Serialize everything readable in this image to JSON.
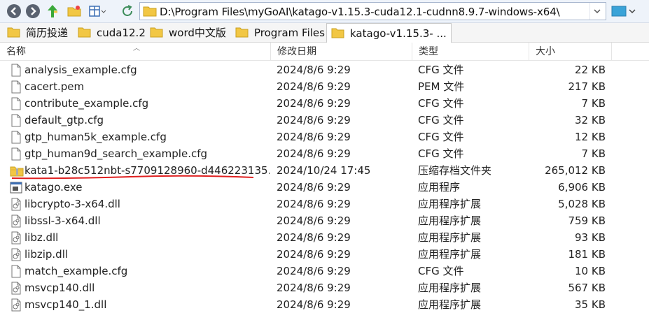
{
  "address": {
    "path": "D:\\Program Files\\myGoAI\\katago-v1.15.3-cuda12.1-cudnn8.9.7-windows-x64\\"
  },
  "favorites": [
    {
      "label": "简历投递"
    },
    {
      "label": "cuda12.2"
    },
    {
      "label": "word中文版"
    },
    {
      "label": "Program Files"
    },
    {
      "label": "katago-v1.15.3- ..."
    }
  ],
  "columns": {
    "name": "名称",
    "date": "修改日期",
    "type": "类型",
    "size": "大小"
  },
  "files": [
    {
      "name": "analysis_example.cfg",
      "date": "2024/8/6 9:29",
      "type": "CFG 文件",
      "size": "22 KB",
      "icon": "file-icon"
    },
    {
      "name": "cacert.pem",
      "date": "2024/8/6 9:29",
      "type": "PEM 文件",
      "size": "217 KB",
      "icon": "file-icon"
    },
    {
      "name": "contribute_example.cfg",
      "date": "2024/8/6 9:29",
      "type": "CFG 文件",
      "size": "7 KB",
      "icon": "file-icon"
    },
    {
      "name": "default_gtp.cfg",
      "date": "2024/8/6 9:29",
      "type": "CFG 文件",
      "size": "32 KB",
      "icon": "file-icon"
    },
    {
      "name": "gtp_human5k_example.cfg",
      "date": "2024/8/6 9:29",
      "type": "CFG 文件",
      "size": "12 KB",
      "icon": "file-icon"
    },
    {
      "name": "gtp_human9d_search_example.cfg",
      "date": "2024/8/6 9:29",
      "type": "CFG 文件",
      "size": "7 KB",
      "icon": "file-icon"
    },
    {
      "name": "kata1-b28c512nbt-s7709128960-d446223135...",
      "date": "2024/10/24 17:45",
      "type": "压缩存档文件夹",
      "size": "265,012 KB",
      "icon": "zip-folder-icon"
    },
    {
      "name": "katago.exe",
      "date": "2024/8/6 9:29",
      "type": "应用程序",
      "size": "6,906 KB",
      "icon": "exe-icon"
    },
    {
      "name": "libcrypto-3-x64.dll",
      "date": "2024/8/6 9:29",
      "type": "应用程序扩展",
      "size": "5,028 KB",
      "icon": "dll-icon"
    },
    {
      "name": "libssl-3-x64.dll",
      "date": "2024/8/6 9:29",
      "type": "应用程序扩展",
      "size": "759 KB",
      "icon": "dll-icon"
    },
    {
      "name": "libz.dll",
      "date": "2024/8/6 9:29",
      "type": "应用程序扩展",
      "size": "93 KB",
      "icon": "dll-icon"
    },
    {
      "name": "libzip.dll",
      "date": "2024/8/6 9:29",
      "type": "应用程序扩展",
      "size": "181 KB",
      "icon": "dll-icon"
    },
    {
      "name": "match_example.cfg",
      "date": "2024/8/6 9:29",
      "type": "CFG 文件",
      "size": "10 KB",
      "icon": "file-icon"
    },
    {
      "name": "msvcp140.dll",
      "date": "2024/8/6 9:29",
      "type": "应用程序扩展",
      "size": "567 KB",
      "icon": "dll-icon"
    },
    {
      "name": "msvcp140_1.dll",
      "date": "2024/8/6 9:29",
      "type": "应用程序扩展",
      "size": "35 KB",
      "icon": "dll-icon"
    }
  ],
  "colors": {
    "annotation_underline": "#e02020",
    "folder": "#f2c744"
  }
}
